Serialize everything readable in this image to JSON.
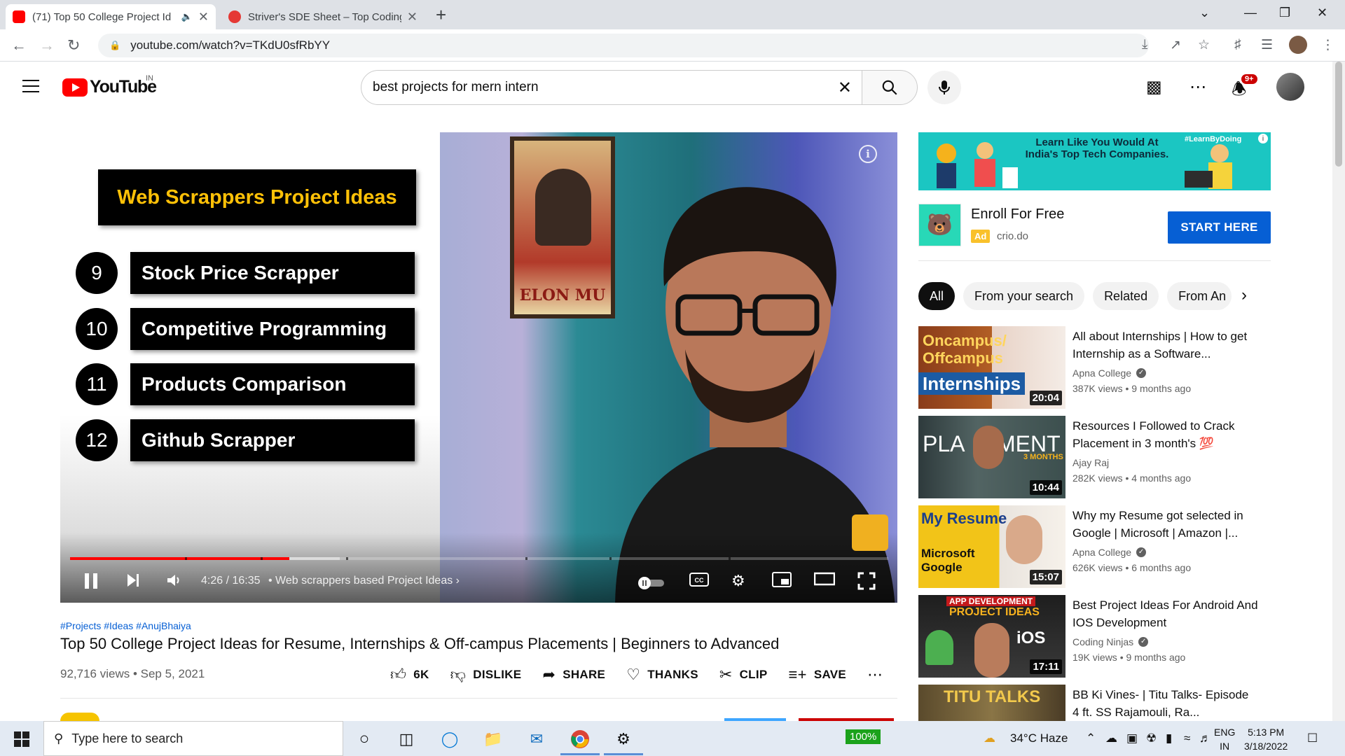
{
  "browser": {
    "tabs": [
      {
        "title": "(71) Top 50 College Project Id",
        "active": true,
        "favicon_color": "#ff0000"
      },
      {
        "title": "Striver's SDE Sheet – Top Coding",
        "active": false,
        "favicon_color": "#e53935"
      }
    ],
    "url": "youtube.com/watch?v=TKdU0sfRbYY"
  },
  "youtube": {
    "logo_text": "YouTube",
    "country": "IN",
    "search_value": "best projects for mern intern",
    "notification_count": "9+"
  },
  "player": {
    "slide_title": "Web Scrappers Project Ideas",
    "ideas": [
      {
        "num": "9",
        "label": "Stock Price Scrapper"
      },
      {
        "num": "10",
        "label": "Competitive Programming"
      },
      {
        "num": "11",
        "label": "Products Comparison"
      },
      {
        "num": "12",
        "label": "Github Scrapper"
      }
    ],
    "poster_text": "ELON MU",
    "current_time": "4:26",
    "duration": "16:35",
    "time_display": "4:26 / 16:35",
    "chapter": "Web scrappers based Project Ideas",
    "played_fraction": 0.268,
    "buffered_fraction": 0.33
  },
  "video": {
    "hashtags": "#Projects #Ideas #AnujBhaiya",
    "title": "Top 50 College Project Ideas for Resume, Internships & Off-campus Placements | Beginners to Advanced",
    "meta": "92,716 views • Sep 5, 2021",
    "actions": {
      "like": "6K",
      "dislike": "DISLIKE",
      "share": "SHARE",
      "thanks": "THANKS",
      "clip": "CLIP",
      "save": "SAVE"
    }
  },
  "ad": {
    "banner_text": "Learn Like You Would At India's Top Tech Companies.",
    "banner_tag": "#LearnByDoing",
    "name": "Enroll For Free",
    "badge": "Ad",
    "domain": "crio.do",
    "cta": "START HERE"
  },
  "chips": [
    "All",
    "From your search",
    "Related",
    "From An"
  ],
  "recommendations": [
    {
      "title": "All about Internships | How to get Internship as a Software...",
      "channel": "Apna College",
      "verified": true,
      "views": "387K views • 9 months ago",
      "duration": "20:04",
      "thumb_text1": "Oncampus/",
      "thumb_text2": "Offcampus",
      "thumb_text3": "Internships"
    },
    {
      "title": "Resources I Followed to Crack Placement in 3 month's 💯",
      "channel": "Ajay Raj",
      "verified": false,
      "views": "282K views • 4 months ago",
      "duration": "10:44",
      "thumb_text1": "PLA",
      "thumb_text2": "MENT",
      "thumb_text3": "3 MONTHS"
    },
    {
      "title": "Why my Resume got selected in Google | Microsoft | Amazon |...",
      "channel": "Apna College",
      "verified": true,
      "views": "626K views • 6 months ago",
      "duration": "15:07",
      "thumb_text1": "My Resume",
      "thumb_text2": "Microsoft",
      "thumb_text3": "Google"
    },
    {
      "title": "Best Project Ideas For Android And IOS Development",
      "channel": "Coding Ninjas",
      "verified": true,
      "views": "19K views • 9 months ago",
      "duration": "17:11",
      "thumb_text1": "APP DEVELOPMENT",
      "thumb_text2": "PROJECT IDEAS",
      "thumb_text3": "iOS"
    },
    {
      "title": "BB Ki Vines- | Titu Talks- Episode 4 ft. SS Rajamouli, Ra...",
      "channel": "",
      "verified": false,
      "views": "",
      "duration": "",
      "thumb_text1": "TITU TALKS",
      "thumb_text2": "",
      "thumb_text3": ""
    }
  ],
  "taskbar": {
    "search_placeholder": "Type here to search",
    "battery": "100%",
    "weather": "34°C  Haze",
    "lang1": "ENG",
    "lang2": "IN",
    "time": "5:13 PM",
    "date": "3/18/2022"
  }
}
